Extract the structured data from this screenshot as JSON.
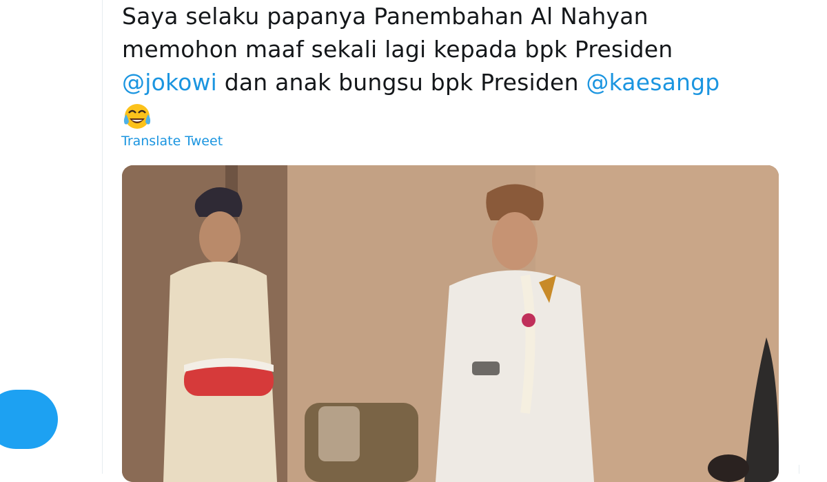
{
  "tweet": {
    "lines": [
      "Saya selaku papanya Panembahan Al Nahyan",
      "memohon maaf sekali lagi kepada bpk Presiden"
    ],
    "mention_1": "@jokowi",
    "middle_text": " dan anak bungsu bpk Presiden ",
    "mention_2": "@kaesangp",
    "emoji": "face-with-tears-of-joy",
    "translate_label": "Translate Tweet"
  },
  "media": {
    "type": "photo"
  },
  "colors": {
    "link": "#1b95e0",
    "text": "#14171a",
    "button": "#1da1f2"
  }
}
